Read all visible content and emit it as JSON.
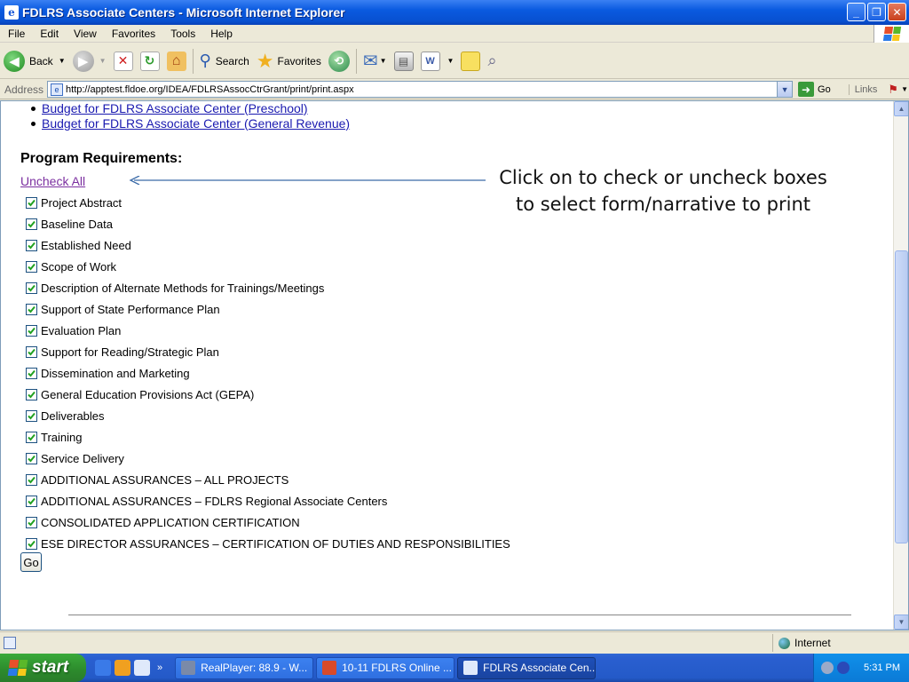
{
  "window": {
    "title": "FDLRS Associate Centers - Microsoft Internet Explorer"
  },
  "menu": [
    "File",
    "Edit",
    "View",
    "Favorites",
    "Tools",
    "Help"
  ],
  "toolbar": {
    "back": "Back",
    "search": "Search",
    "favorites": "Favorites"
  },
  "address": {
    "label": "Address",
    "url": "http://apptest.fldoe.org/IDEA/FDLRSAssocCtrGrant/print/print.aspx",
    "go": "Go",
    "links": "Links"
  },
  "page": {
    "budget_links": [
      "Budget for FDLRS Associate Center (Preschool)",
      "Budget for FDLRS Associate Center (General Revenue)"
    ],
    "heading": "Program Requirements:",
    "uncheck_all": "Uncheck All",
    "annotation": "Click on to check or uncheck boxes to select form/narrative to print",
    "requirements": [
      "Project Abstract",
      "Baseline Data",
      "Established Need",
      "Scope of Work",
      "Description of Alternate Methods for Trainings/Meetings",
      "Support of State Performance Plan",
      "Evaluation Plan",
      "Support for Reading/Strategic Plan",
      "Dissemination and Marketing",
      "General Education Provisions Act (GEPA)",
      "Deliverables",
      "Training",
      "Service Delivery",
      "ADDITIONAL ASSURANCES – ALL PROJECTS",
      "ADDITIONAL ASSURANCES – FDLRS Regional Associate Centers",
      "CONSOLIDATED APPLICATION CERTIFICATION",
      "ESE DIRECTOR ASSURANCES – CERTIFICATION OF DUTIES AND RESPONSIBILITIES"
    ],
    "go_button": "Go"
  },
  "status": {
    "zone": "Internet"
  },
  "taskbar": {
    "start": "start",
    "tasks": [
      "RealPlayer: 88.9 - W...",
      "10-11 FDLRS Online ...",
      "FDLRS Associate Cen..."
    ],
    "clock": "5:31 PM"
  },
  "colors": {
    "link": "#1a1ab0",
    "visited_link": "#7b2fa0",
    "titlebar": "#0a5ae0",
    "annotation_arrow": "#3a6aa8"
  }
}
